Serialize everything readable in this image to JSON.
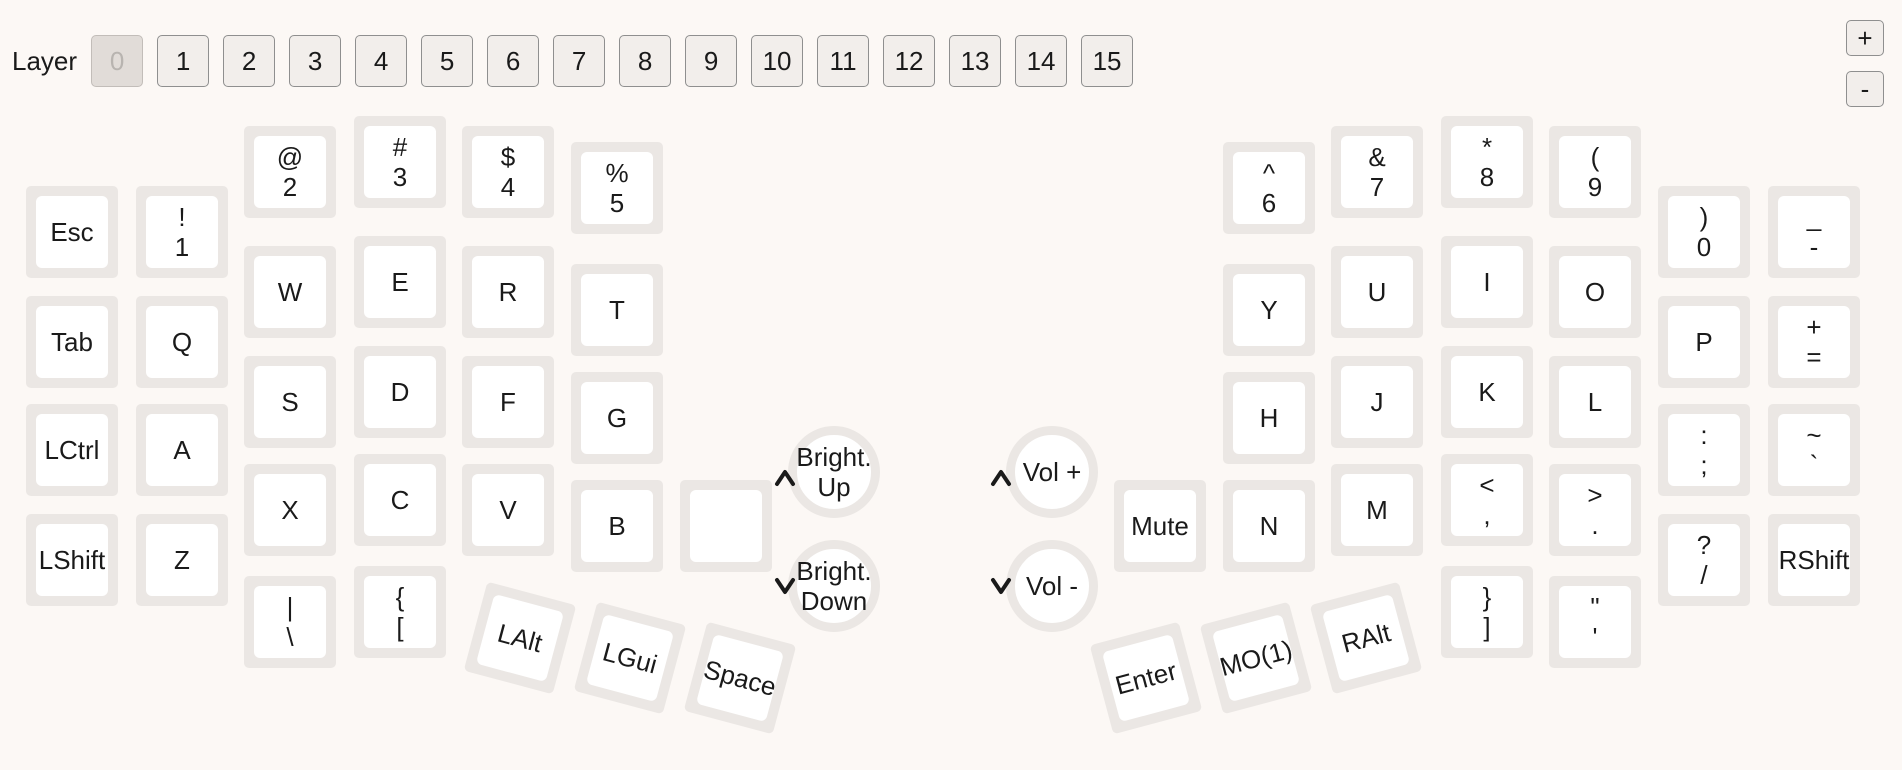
{
  "layer_bar": {
    "label": "Layer",
    "layers": [
      "0",
      "1",
      "2",
      "3",
      "4",
      "5",
      "6",
      "7",
      "8",
      "9",
      "10",
      "11",
      "12",
      "13",
      "14",
      "15"
    ],
    "active_layer": "0"
  },
  "zoom": {
    "plus": "+",
    "minus": "-"
  },
  "keys": [
    {
      "name": "key-esc",
      "lines": [
        "Esc"
      ]
    },
    {
      "name": "key-1",
      "lines": [
        "!",
        "1"
      ]
    },
    {
      "name": "key-2",
      "lines": [
        "@",
        "2"
      ]
    },
    {
      "name": "key-3",
      "lines": [
        "#",
        "3"
      ]
    },
    {
      "name": "key-4",
      "lines": [
        "$",
        "4"
      ]
    },
    {
      "name": "key-5",
      "lines": [
        "%",
        "5"
      ]
    },
    {
      "name": "key-6",
      "lines": [
        "^",
        "6"
      ]
    },
    {
      "name": "key-7",
      "lines": [
        "&",
        "7"
      ]
    },
    {
      "name": "key-8",
      "lines": [
        "*",
        "8"
      ]
    },
    {
      "name": "key-9",
      "lines": [
        "(",
        "9"
      ]
    },
    {
      "name": "key-0",
      "lines": [
        ")",
        "0"
      ]
    },
    {
      "name": "key-minus",
      "lines": [
        "_",
        "-"
      ]
    },
    {
      "name": "key-tab",
      "lines": [
        "Tab"
      ]
    },
    {
      "name": "key-q",
      "lines": [
        "Q"
      ]
    },
    {
      "name": "key-w",
      "lines": [
        "W"
      ]
    },
    {
      "name": "key-e",
      "lines": [
        "E"
      ]
    },
    {
      "name": "key-r",
      "lines": [
        "R"
      ]
    },
    {
      "name": "key-t",
      "lines": [
        "T"
      ]
    },
    {
      "name": "key-y",
      "lines": [
        "Y"
      ]
    },
    {
      "name": "key-u",
      "lines": [
        "U"
      ]
    },
    {
      "name": "key-i",
      "lines": [
        "I"
      ]
    },
    {
      "name": "key-o",
      "lines": [
        "O"
      ]
    },
    {
      "name": "key-p",
      "lines": [
        "P"
      ]
    },
    {
      "name": "key-equal",
      "lines": [
        "+",
        "="
      ]
    },
    {
      "name": "key-lctrl",
      "lines": [
        "LCtrl"
      ]
    },
    {
      "name": "key-a",
      "lines": [
        "A"
      ]
    },
    {
      "name": "key-s",
      "lines": [
        "S"
      ]
    },
    {
      "name": "key-d",
      "lines": [
        "D"
      ]
    },
    {
      "name": "key-f",
      "lines": [
        "F"
      ]
    },
    {
      "name": "key-g",
      "lines": [
        "G"
      ]
    },
    {
      "name": "key-h",
      "lines": [
        "H"
      ]
    },
    {
      "name": "key-j",
      "lines": [
        "J"
      ]
    },
    {
      "name": "key-k",
      "lines": [
        "K"
      ]
    },
    {
      "name": "key-l",
      "lines": [
        "L"
      ]
    },
    {
      "name": "key-semicolon",
      "lines": [
        ":",
        ";"
      ]
    },
    {
      "name": "key-grave",
      "lines": [
        "~",
        "`"
      ]
    },
    {
      "name": "key-lshift",
      "lines": [
        "LShift"
      ]
    },
    {
      "name": "key-z",
      "lines": [
        "Z"
      ]
    },
    {
      "name": "key-x",
      "lines": [
        "X"
      ]
    },
    {
      "name": "key-c",
      "lines": [
        "C"
      ]
    },
    {
      "name": "key-v",
      "lines": [
        "V"
      ]
    },
    {
      "name": "key-b",
      "lines": [
        "B"
      ]
    },
    {
      "name": "key-blank",
      "lines": []
    },
    {
      "name": "key-mute",
      "lines": [
        "Mute"
      ]
    },
    {
      "name": "key-n",
      "lines": [
        "N"
      ]
    },
    {
      "name": "key-m",
      "lines": [
        "M"
      ]
    },
    {
      "name": "key-comma",
      "lines": [
        "<",
        ","
      ]
    },
    {
      "name": "key-period",
      "lines": [
        ">",
        "."
      ]
    },
    {
      "name": "key-slash",
      "lines": [
        "?",
        "/"
      ]
    },
    {
      "name": "key-rshift",
      "lines": [
        "RShift"
      ]
    },
    {
      "name": "key-backslash",
      "lines": [
        "|",
        "\\"
      ]
    },
    {
      "name": "key-lbracket",
      "lines": [
        "{",
        "["
      ]
    },
    {
      "name": "key-rbracket",
      "lines": [
        "}",
        "]"
      ]
    },
    {
      "name": "key-quote",
      "lines": [
        "\"",
        "'"
      ]
    },
    {
      "name": "key-lalt",
      "lines": [
        "LAlt"
      ]
    },
    {
      "name": "key-lgui",
      "lines": [
        "LGui"
      ]
    },
    {
      "name": "key-space",
      "lines": [
        "Space"
      ]
    },
    {
      "name": "key-enter",
      "lines": [
        "Enter"
      ]
    },
    {
      "name": "key-mo1",
      "lines": [
        "MO(1)"
      ]
    },
    {
      "name": "key-ralt",
      "lines": [
        "RAlt"
      ]
    }
  ],
  "encoders": [
    {
      "name": "encoder-bright-up",
      "lines": [
        "Bright.",
        "Up"
      ],
      "icon": "chevron-up-icon"
    },
    {
      "name": "encoder-bright-down",
      "lines": [
        "Bright.",
        "Down"
      ],
      "icon": "chevron-down-icon"
    },
    {
      "name": "encoder-vol-up",
      "lines": [
        "Vol +"
      ],
      "icon": "chevron-up-icon"
    },
    {
      "name": "encoder-vol-down",
      "lines": [
        "Vol -"
      ],
      "icon": "chevron-down-icon"
    }
  ]
}
